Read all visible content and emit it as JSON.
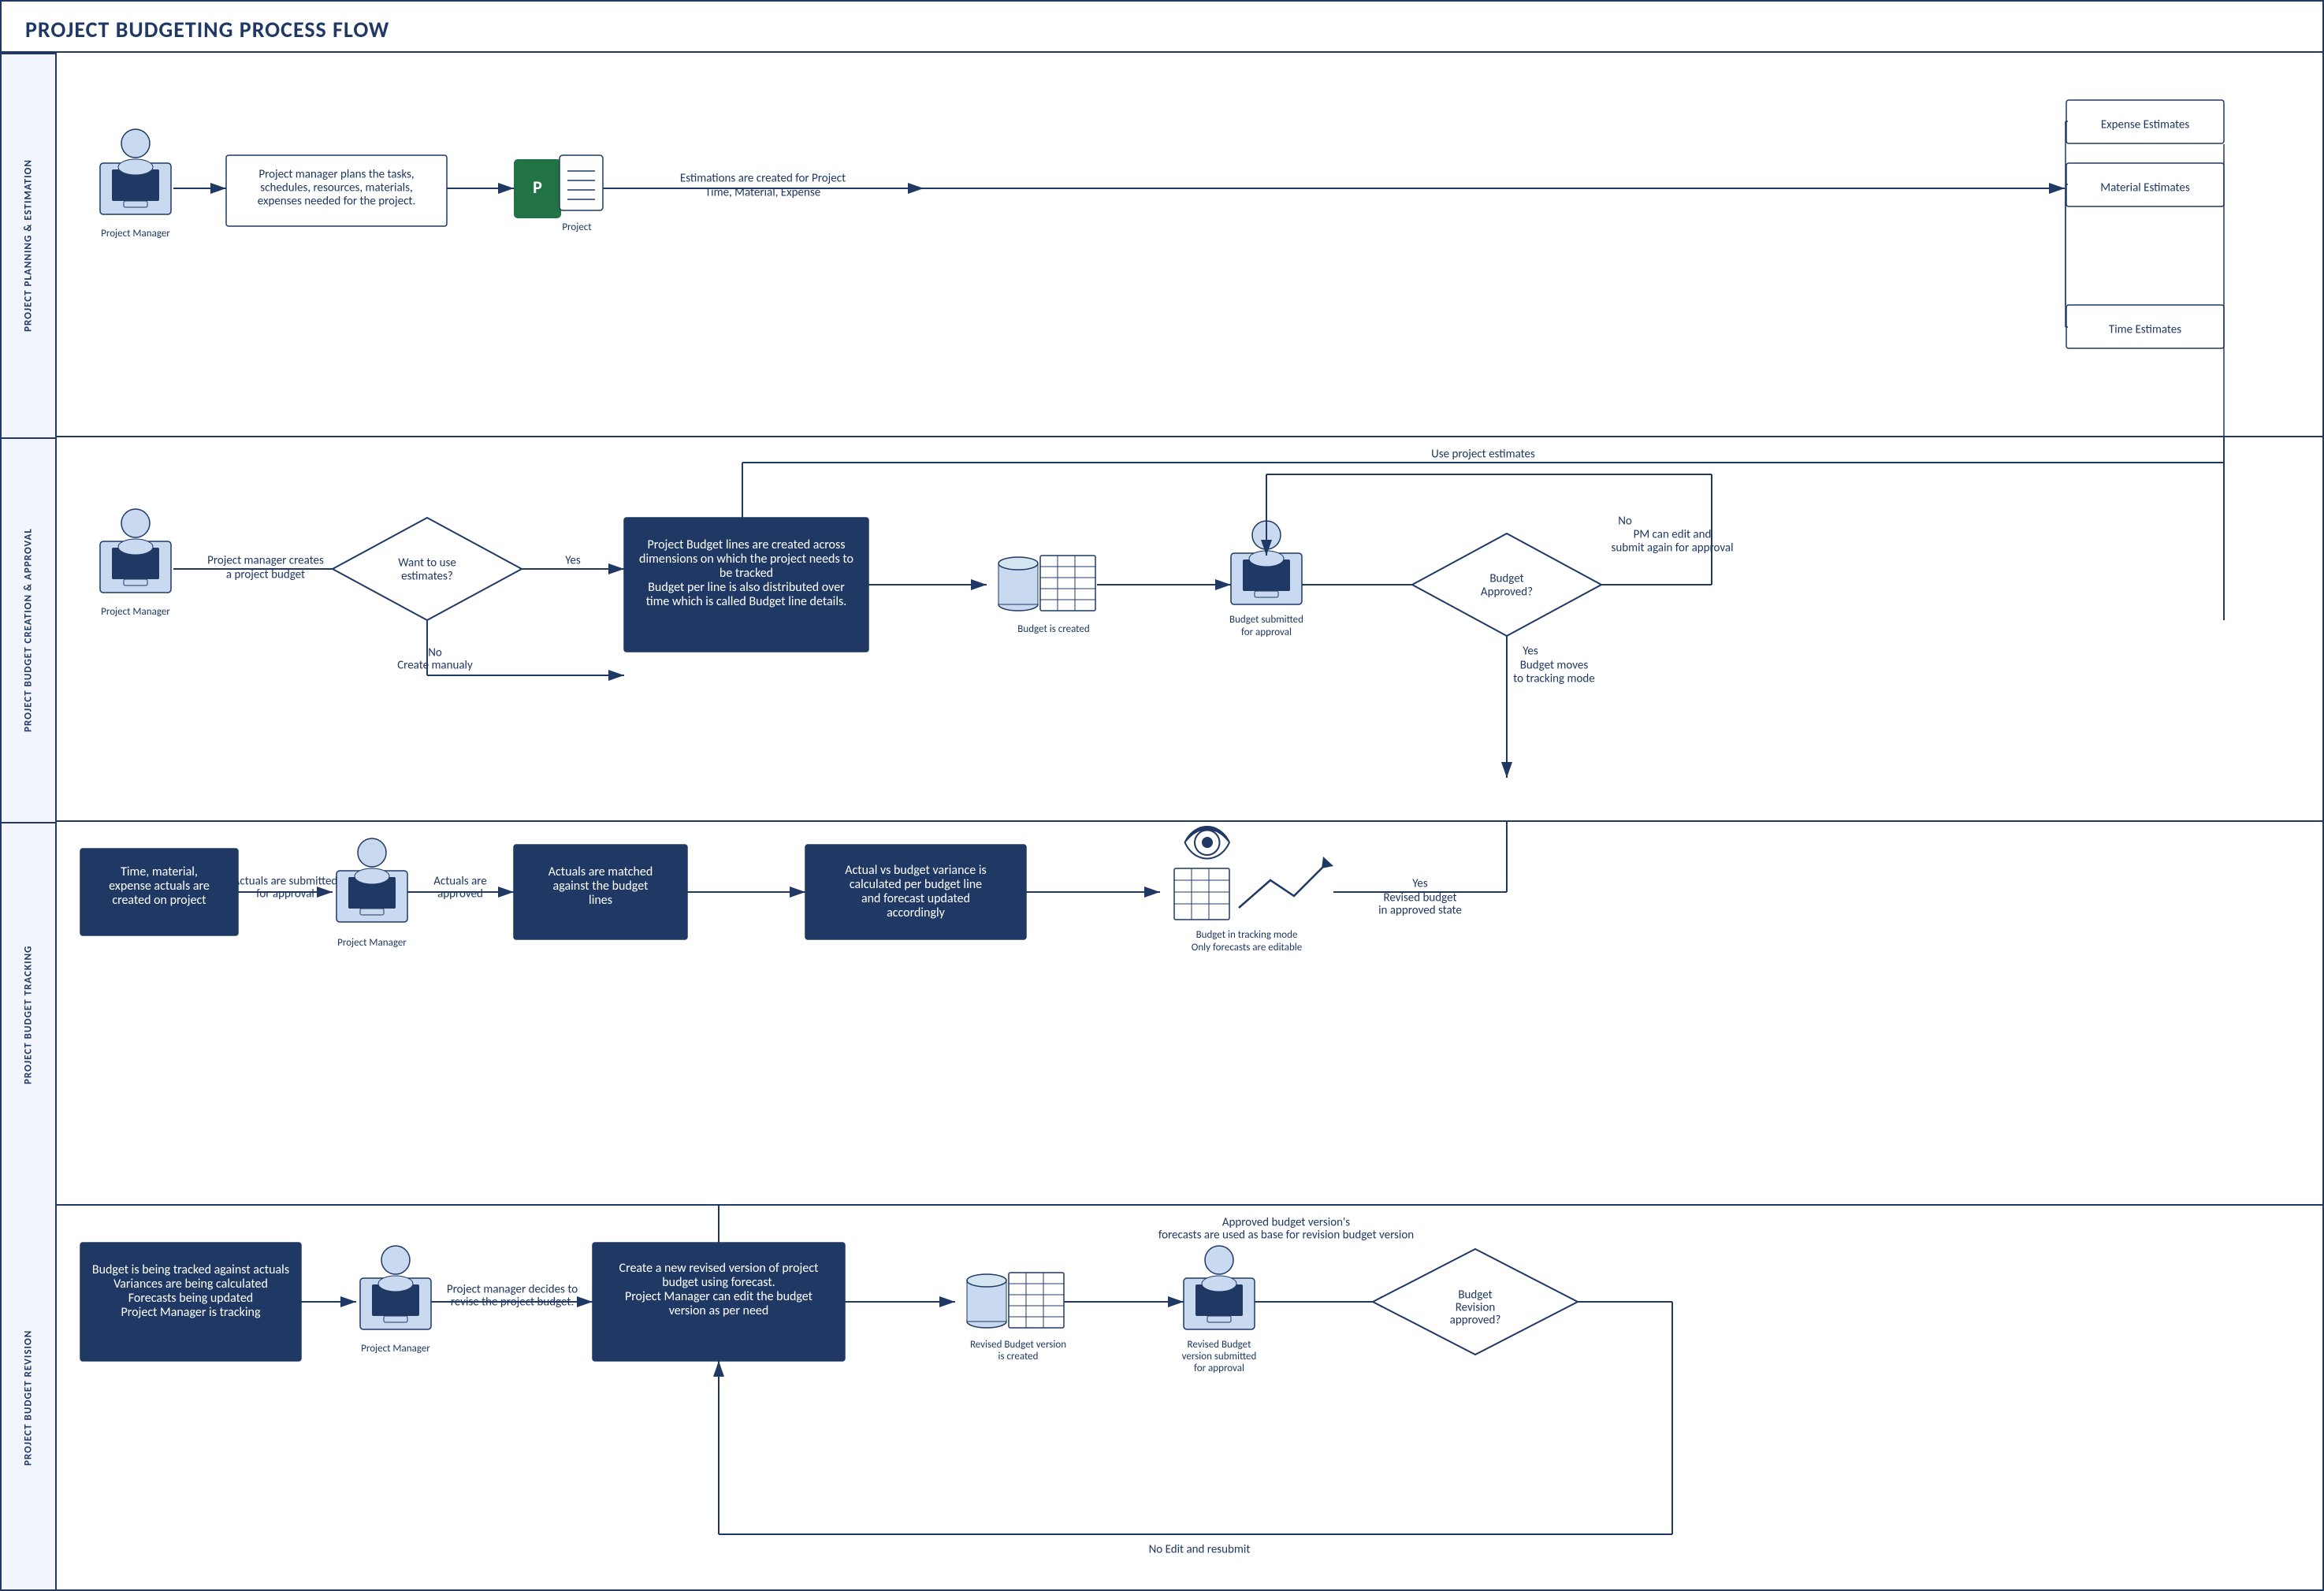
{
  "title": "PROJECT BUDGETING PROCESS FLOW",
  "swimlanes": [
    {
      "id": "sl1",
      "label": "PROJECT PLANNING & ESTIMATION"
    },
    {
      "id": "sl2",
      "label": "PROJECT BUDGET CREATION & APPROVAL"
    },
    {
      "id": "sl3",
      "label": "PROJECT BUDGET TRACKING"
    },
    {
      "id": "sl4",
      "label": "PROJECT BUDGET REVISION"
    }
  ],
  "row1": {
    "actor": "Project Manager",
    "step1": "Project manager plans the tasks, schedules, resources, materials, expenses needed for the project.",
    "step2": "Project",
    "arrow_text": "Estimations are created for Project Time, Material, Expense",
    "boxes": [
      "Expense Estimates",
      "Material Estimates",
      "Time Estimates"
    ]
  },
  "row2": {
    "actor": "Project Manager",
    "step1": "Project manager creates a project budget",
    "diamond": "Want to use estimates?",
    "yes": "Yes",
    "no_bottom": "No\nCreate manualy",
    "main_box": "Project Budget lines are created across dimensions on which the project needs to be tracked\nBudget per line is also distributed over time which is called Budget line details.",
    "budget_created": "Budget is created",
    "submitted": "Budget submitted for approval",
    "diamond2": "Budget Approved?",
    "no_top": "No\nPM can edit and submit again for approval",
    "yes2": "Yes\nBudget moves to tracking mode",
    "use_estimates": "Use project estimates"
  },
  "row3": {
    "box1": "Time, material, expense actuals are created on project",
    "arrow1": "Actuals are submitted for approval",
    "actor": "Project Manager",
    "arrow2": "Actuals are approved",
    "box2": "Actuals are matched against the budget lines",
    "box3": "Actual vs budget variance is calculated per budget line and forecast updated accordingly",
    "tracking": "Budget in tracking mode\nOnly forecasts are editable",
    "yes": "Yes\nRevised budget in approved state"
  },
  "row4": {
    "box1": "Budget is being tracked against actuals\nVariances are being calculated\nForecasts being updated\nProject Manager is tracking",
    "actor": "Project Manager",
    "arrow1": "Project manager decides to revise the project budget.",
    "main_box": "Create a new revised version of project budget using forecast.\nProject Manager can edit the budget version as per need",
    "revised_created": "Revised Budget version is created",
    "submitted": "Revised Budget version submitted for approval",
    "diamond": "Budget Revision approved?",
    "no_bottom": "No Edit and resubmit",
    "top_note": "Approved budget version's forecasts are used as base for revision budget version"
  }
}
